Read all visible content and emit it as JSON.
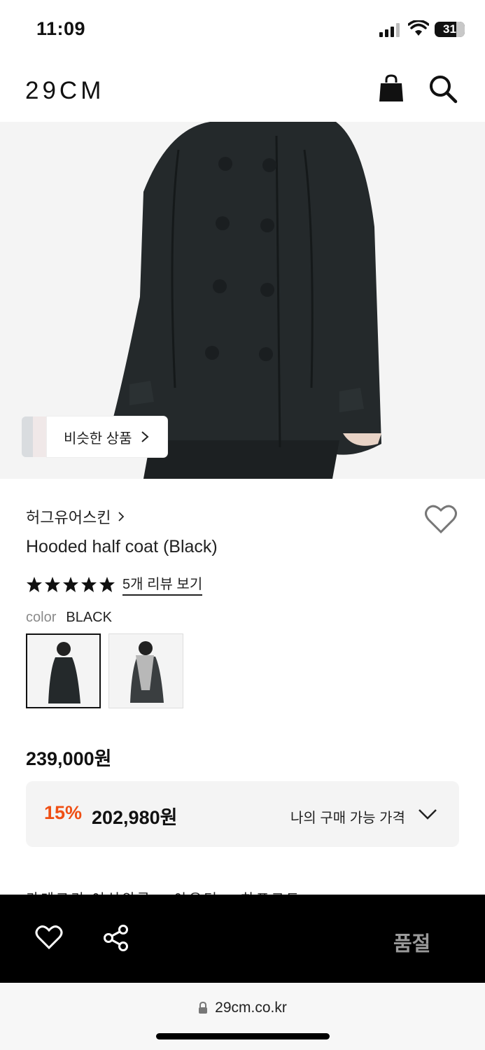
{
  "status_bar": {
    "time": "11:09",
    "battery": "31"
  },
  "header": {
    "logo": "29CM"
  },
  "hero": {
    "similar_label": "비슷한 상품"
  },
  "product": {
    "brand": "허그유어스킨",
    "name": "Hooded half coat (Black)",
    "rating_stars": 5,
    "review_link": "5개 리뷰 보기",
    "color_label": "color",
    "color_value": "BLACK",
    "price": "239,000원",
    "discount_percent": "15%",
    "discount_price": "202,980원",
    "my_price_label": "나의 구매 가능 가격",
    "category_text": "카테고리 여성의류 > 아우터 > 하프코트"
  },
  "bottom_bar": {
    "action_label": "품절"
  },
  "browser": {
    "url": "29cm.co.kr"
  },
  "colors": {
    "accent_discount": "#ef4f14",
    "bottom_bar_bg": "#000000",
    "soldout_text": "#9a9a9a"
  },
  "icons": [
    "bag-icon",
    "search-icon",
    "heart-icon",
    "share-icon",
    "lock-icon",
    "chevron-down-icon",
    "chevron-right-icon",
    "star-icon"
  ]
}
